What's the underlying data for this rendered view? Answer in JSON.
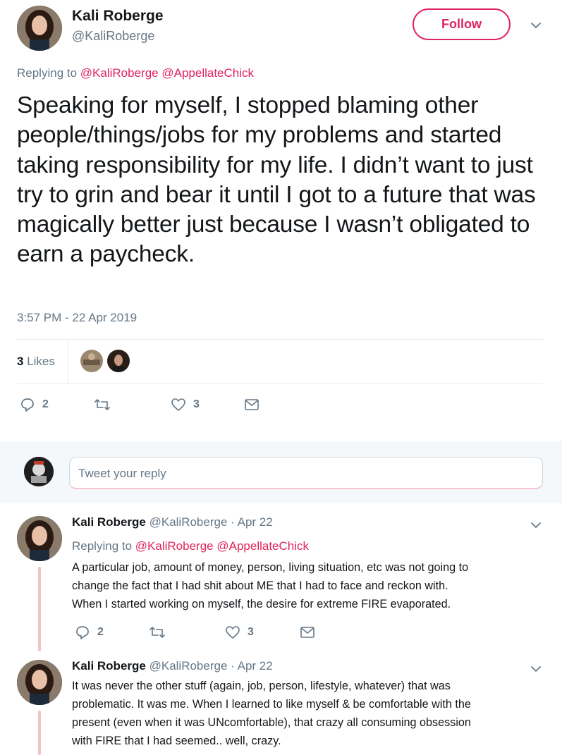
{
  "main_tweet": {
    "name": "Kali Roberge",
    "handle": "@KaliRoberge",
    "follow_label": "Follow",
    "replying_prefix": "Replying to",
    "mention_1": "@KaliRoberge",
    "mention_2": "@AppellateChick",
    "text": "Speaking for myself, I stopped blaming other people/things/jobs for my problems and started taking responsibility for my life. I didn’t want to just try to grin and bear it until I got to a future that was magically better just because I wasn’t obligated to earn a paycheck.",
    "timestamp": "3:57 PM - 22 Apr 2019",
    "likes_count": "3",
    "likes_label": "Likes",
    "reply_count": "2",
    "like_count": "3"
  },
  "reply_box": {
    "placeholder": "Tweet your reply"
  },
  "replies": [
    {
      "name": "Kali Roberge",
      "handle": "@KaliRoberge",
      "date": "· Apr 22",
      "replying_prefix": "Replying to",
      "mention_1": "@KaliRoberge",
      "mention_2": "@AppellateChick",
      "line_1": "A particular job, amount of money, person, living situation, etc was not going to",
      "line_2": "change the fact that I had shit about ME that I had to face and reckon with.",
      "line_3": "When I started working on myself, the desire for extreme FIRE evaporated.",
      "reply_count": "2",
      "like_count": "3"
    },
    {
      "name": "Kali Roberge",
      "handle": "@KaliRoberge",
      "date": "· Apr 22",
      "line_1": "It was never the other stuff (again, job, person, lifestyle, whatever) that was",
      "line_2": "problematic. It was me. When I learned to like myself & be comfortable with the",
      "line_3": "present (even when it was UNcomfortable), that crazy all consuming obsession",
      "line_4": "with FIRE that I had seemed.. well, crazy."
    }
  ],
  "icons": {
    "reply": "speech-bubble-icon",
    "retweet": "retweet-icon",
    "like": "heart-icon",
    "dm": "envelope-icon",
    "caret": "chevron-down-icon"
  },
  "colors": {
    "accent": "#e0245e",
    "muted": "#657786",
    "text": "#14171a",
    "divider": "#e6ecf0",
    "band": "#f5f8fa"
  }
}
